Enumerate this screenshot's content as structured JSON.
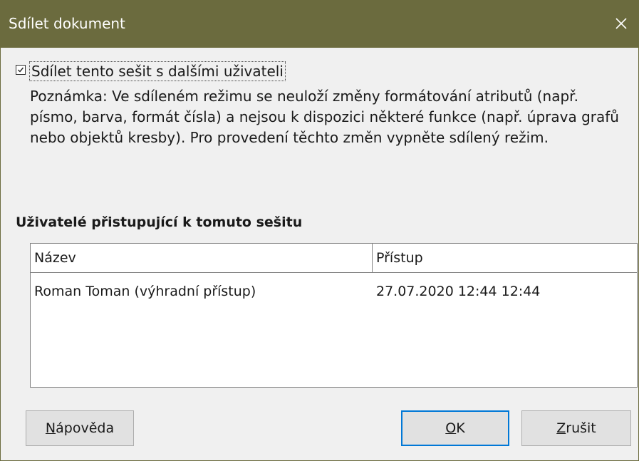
{
  "dialog": {
    "title": "Sdílet dokument",
    "colors": {
      "titlebar": "#6b6b3e",
      "background": "#f0f0f0",
      "focus_border": "#0078d7"
    }
  },
  "share": {
    "checked": true,
    "label": "Sdílet tento sešit s dalšími uživateli"
  },
  "note": "Poznámka: Ve sdíleném režimu se neuloží změny formátování atributů (např. písmo, barva, formát čísla) a nejsou k dispozici některé funkce (např. úprava grafů nebo objektů kresby). Pro provedení těchto změn vypněte sdílený režim.",
  "users": {
    "heading": "Uživatelé přistupující k tomuto sešitu",
    "columns": {
      "name": "Název",
      "access": "Přístup"
    },
    "rows": [
      {
        "name": "Roman Toman (výhradní přístup)",
        "access": "27.07.2020 12:44 12:44"
      }
    ]
  },
  "buttons": {
    "help": {
      "mnemonic": "N",
      "rest": "ápověda"
    },
    "ok": {
      "mnemonic": "O",
      "rest": "K"
    },
    "cancel": {
      "mnemonic": "Z",
      "rest": "rušit"
    }
  },
  "icons": {
    "close": "close-icon",
    "checkmark": "checkmark-icon"
  }
}
